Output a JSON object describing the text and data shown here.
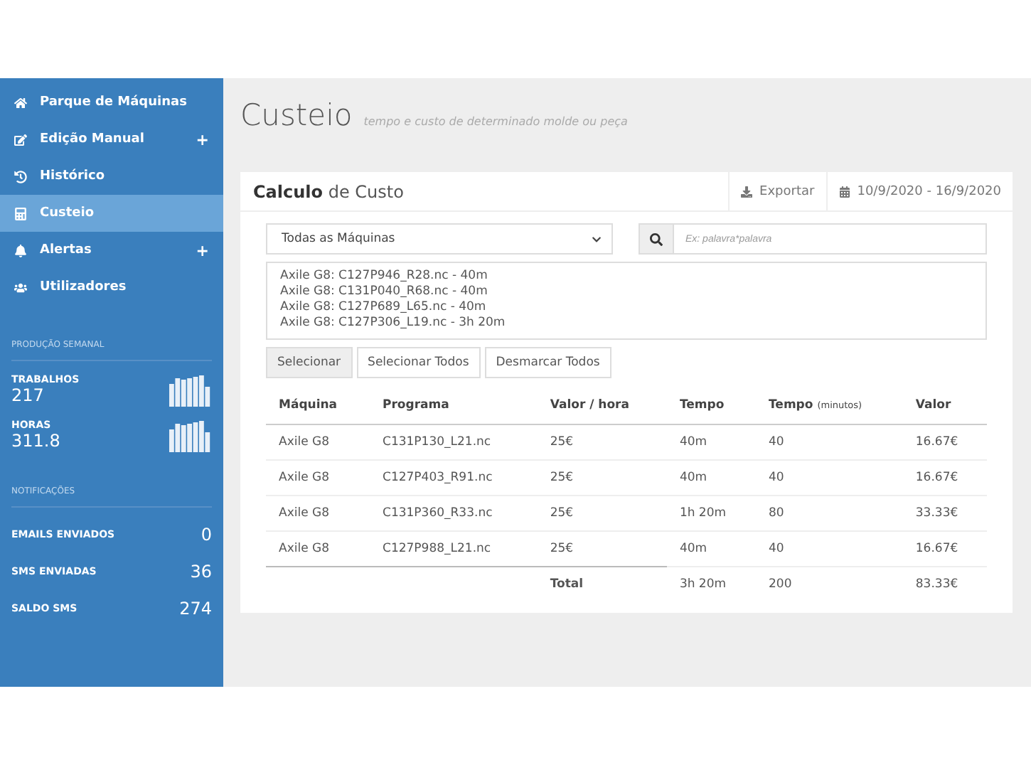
{
  "sidebar": {
    "items": [
      {
        "label": "Parque de Máquinas",
        "selected": false
      },
      {
        "label": "Edição Manual",
        "selected": false,
        "expand_sign": "+"
      },
      {
        "label": "Histórico",
        "selected": false
      },
      {
        "label": "Custeio",
        "selected": true
      },
      {
        "label": "Alertas",
        "selected": false,
        "expand_sign": "+"
      },
      {
        "label": "Utilizadores",
        "selected": false
      }
    ],
    "sections": [
      {
        "heading": "PRODUÇÃO SEMANAL",
        "stats": [
          {
            "kind": "spark",
            "label": "TRABALHOS",
            "value": "217"
          },
          {
            "kind": "spark",
            "label": "HORAS",
            "value": "311.8"
          }
        ]
      },
      {
        "heading": "NOTIFICAÇÕES",
        "stats": [
          {
            "kind": "count",
            "label": "EMAILS ENVIADOS",
            "value": "0"
          },
          {
            "kind": "count",
            "label": "SMS ENVIADAS",
            "value": "36"
          },
          {
            "kind": "count",
            "label": "SALDO SMS",
            "value": "274"
          }
        ]
      }
    ]
  },
  "page": {
    "title": "Custeio",
    "subtitle": "tempo e custo de determinado molde ou peça"
  },
  "panel": {
    "title": "**Calculo** de Custo",
    "export": "Exportar",
    "date_range": "10/9/2020 - 16/9/2020",
    "machine_select": "Todas as Máquinas",
    "search": {
      "placeholder": "Ex: palavra*palavra"
    },
    "programs": [
      "Axile G8: C127P946_R28.nc - 40m",
      "Axile G8: C131P040_R68.nc - 40m",
      "Axile G8: C127P689_L65.nc - 40m",
      "Axile G8: C127P306_L19.nc - 3h 20m"
    ],
    "buttons": [
      {
        "label": "Selecionar",
        "selected": true
      },
      {
        "label": "Selecionar Todos",
        "selected": false
      },
      {
        "label": "Desmarcar Todos",
        "selected": false
      }
    ],
    "table": {
      "columns": [
        {
          "label": "Máquina"
        },
        {
          "label": "Programa"
        },
        {
          "label": "Valor / hora"
        },
        {
          "label": "Tempo"
        },
        {
          "label": "Tempo",
          "unit": "(minutos)"
        },
        {
          "label": "Valor"
        }
      ],
      "rows": [
        [
          "Axile G8",
          "C131P130_L21.nc",
          "25€",
          "40m",
          "40",
          "16.67€"
        ],
        [
          "Axile G8",
          "C127P403_R91.nc",
          "25€",
          "40m",
          "40",
          "16.67€"
        ],
        [
          "Axile G8",
          "C131P360_R33.nc",
          "25€",
          "1h 20m",
          "80",
          "33.33€"
        ],
        [
          "Axile G8",
          "C127P988_L21.nc",
          "25€",
          "40m",
          "40",
          "16.67€"
        ]
      ],
      "total": {
        "label": "Total",
        "values": [
          "3h 20m",
          "200",
          "83.33€"
        ]
      }
    }
  }
}
